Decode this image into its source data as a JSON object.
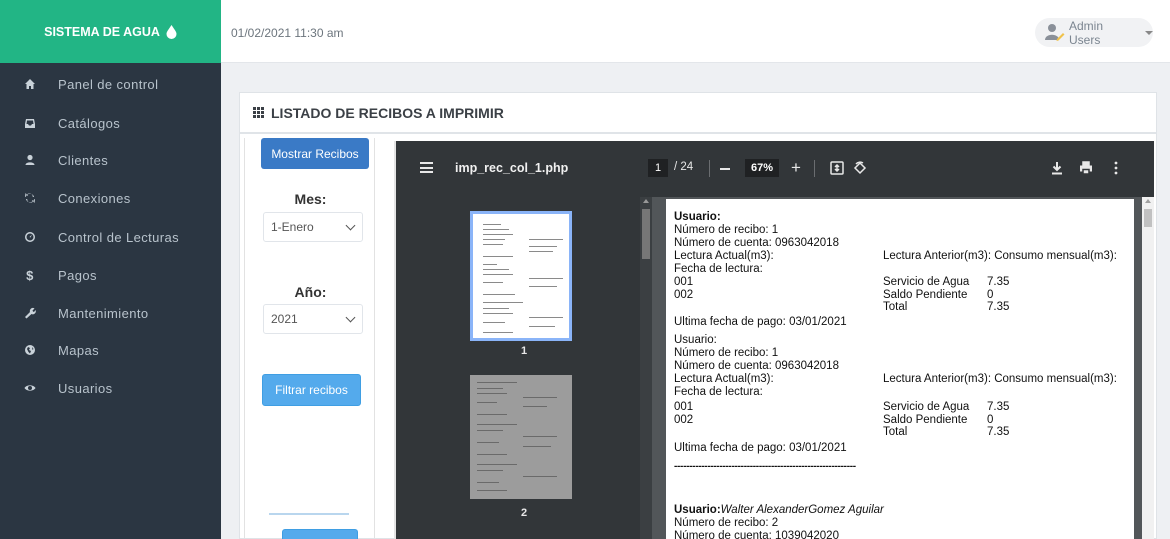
{
  "brand": {
    "title": "SISTEMA DE AGUA",
    "accent": "#22b585"
  },
  "header": {
    "datetime": "01/02/2021 11:30 am",
    "user_label": "Admin Users"
  },
  "sidebar": {
    "items": [
      {
        "label": "Panel de control",
        "icon": "home-icon"
      },
      {
        "label": "Catálogos",
        "icon": "inbox-icon"
      },
      {
        "label": "Clientes",
        "icon": "user-icon"
      },
      {
        "label": "Conexiones",
        "icon": "refresh-icon"
      },
      {
        "label": "Control de Lecturas",
        "icon": "dashboard-icon"
      },
      {
        "label": "Pagos",
        "icon": "dollar-icon",
        "glyph": "$"
      },
      {
        "label": "Mantenimiento",
        "icon": "wrench-icon"
      },
      {
        "label": "Mapas",
        "icon": "globe-icon"
      },
      {
        "label": "Usuarios",
        "icon": "eye-icon"
      }
    ]
  },
  "panel": {
    "title": "LISTADO DE RECIBOS A IMPRIMIR"
  },
  "filters": {
    "show_button": "Mostrar Recibos",
    "month_label": "Mes:",
    "month_value": "1-Enero",
    "year_label": "Año:",
    "year_value": "2021",
    "filter_button": "Filtrar recibos"
  },
  "viewer": {
    "filename": "imp_rec_col_1.php",
    "page": "1",
    "total": "/ 24",
    "zoom": "67%",
    "thumbs": [
      "1",
      "2"
    ]
  },
  "doc": {
    "r1_user_label": "Usuario:",
    "r1_receipt": "Número de recibo: 1",
    "r1_account": "Número de cuenta: 0963042018",
    "r1_current": "Lectura Actual(m3):",
    "r1_prev": "Lectura Anterior(m3): Consumo mensual(m3):",
    "r1_date": "Fecha de lectura:",
    "r1_c1": "001",
    "r1_c2": "002",
    "r1_svc": "Servicio de Agua",
    "r1_svc_v": "7.35",
    "r1_bal": "Saldo Pendiente",
    "r1_bal_v": "0",
    "r1_tot": "Total",
    "r1_tot_v": "7.35",
    "r1_last": "Ultima fecha de pago: 03/01/2021",
    "r2_user_label": "Usuario:",
    "r2_receipt": "Número de recibo: 1",
    "r2_account": "Número de cuenta: 0963042018",
    "r2_current": "Lectura Actual(m3):",
    "r2_prev": "Lectura Anterior(m3): Consumo mensual(m3):",
    "r2_date": "Fecha de lectura:",
    "r2_c1": "001",
    "r2_c2": "002",
    "r2_svc": "Servicio de Agua",
    "r2_svc_v": "7.35",
    "r2_bal": "Saldo Pendiente",
    "r2_bal_v": "0",
    "r2_tot": "Total",
    "r2_tot_v": "7.35",
    "r2_last": "Ultima fecha de pago: 03/01/2021",
    "separator": "------------------------------------------------------------",
    "r3_user_label": "Usuario:",
    "r3_user_name": "Walter AlexanderGomez Aguilar",
    "r3_receipt": "Número de recibo: 2",
    "r3_account": "Número de cuenta: 1039042020"
  }
}
